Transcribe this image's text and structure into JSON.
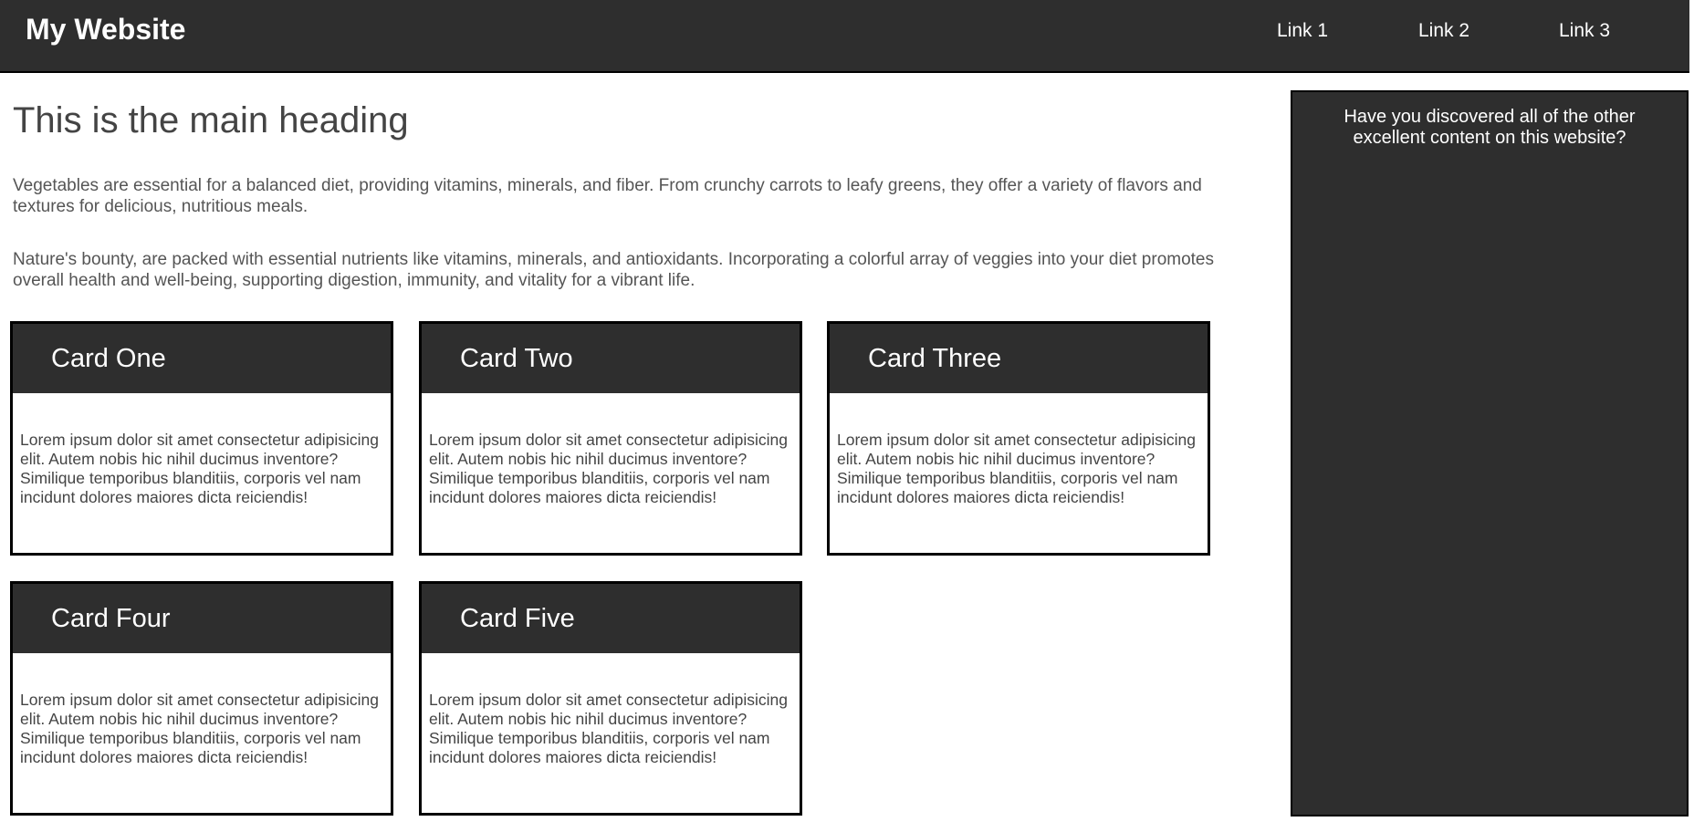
{
  "header": {
    "brand": "My Website",
    "links": [
      "Link 1",
      "Link 2",
      "Link 3"
    ]
  },
  "main": {
    "heading": "This is the main heading",
    "paragraphs": [
      "Vegetables are essential for a balanced diet, providing vitamins, minerals, and fiber. From crunchy carrots to leafy greens, they offer a variety of flavors and textures for delicious, nutritious meals.",
      "Nature's bounty, are packed with essential nutrients like vitamins, minerals, and antioxidants. Incorporating a colorful array of veggies into your diet promotes overall health and well-being, supporting digestion, immunity, and vitality for a vibrant life."
    ],
    "cards": [
      {
        "title": "Card One",
        "body": "Lorem ipsum dolor sit amet consectetur adipisicing elit. Autem nobis hic nihil ducimus inventore? Similique temporibus blanditiis, corporis vel nam incidunt dolores maiores dicta reiciendis!"
      },
      {
        "title": "Card Two",
        "body": "Lorem ipsum dolor sit amet consectetur adipisicing elit. Autem nobis hic nihil ducimus inventore? Similique temporibus blanditiis, corporis vel nam incidunt dolores maiores dicta reiciendis!"
      },
      {
        "title": "Card Three",
        "body": "Lorem ipsum dolor sit amet consectetur adipisicing elit. Autem nobis hic nihil ducimus inventore? Similique temporibus blanditiis, corporis vel nam incidunt dolores maiores dicta reiciendis!"
      },
      {
        "title": "Card Four",
        "body": "Lorem ipsum dolor sit amet consectetur adipisicing elit. Autem nobis hic nihil ducimus inventore? Similique temporibus blanditiis, corporis vel nam incidunt dolores maiores dicta reiciendis!"
      },
      {
        "title": "Card Five",
        "body": "Lorem ipsum dolor sit amet consectetur adipisicing elit. Autem nobis hic nihil ducimus inventore? Similique temporibus blanditiis, corporis vel nam incidunt dolores maiores dicta reiciendis!"
      }
    ]
  },
  "sidebar": {
    "text": "Have you discovered all of the other excellent content on this website?"
  },
  "colors": {
    "dark": "#2e2e2e",
    "border": "#000000",
    "text_dark": "#444444",
    "text_light": "#ffffff"
  }
}
